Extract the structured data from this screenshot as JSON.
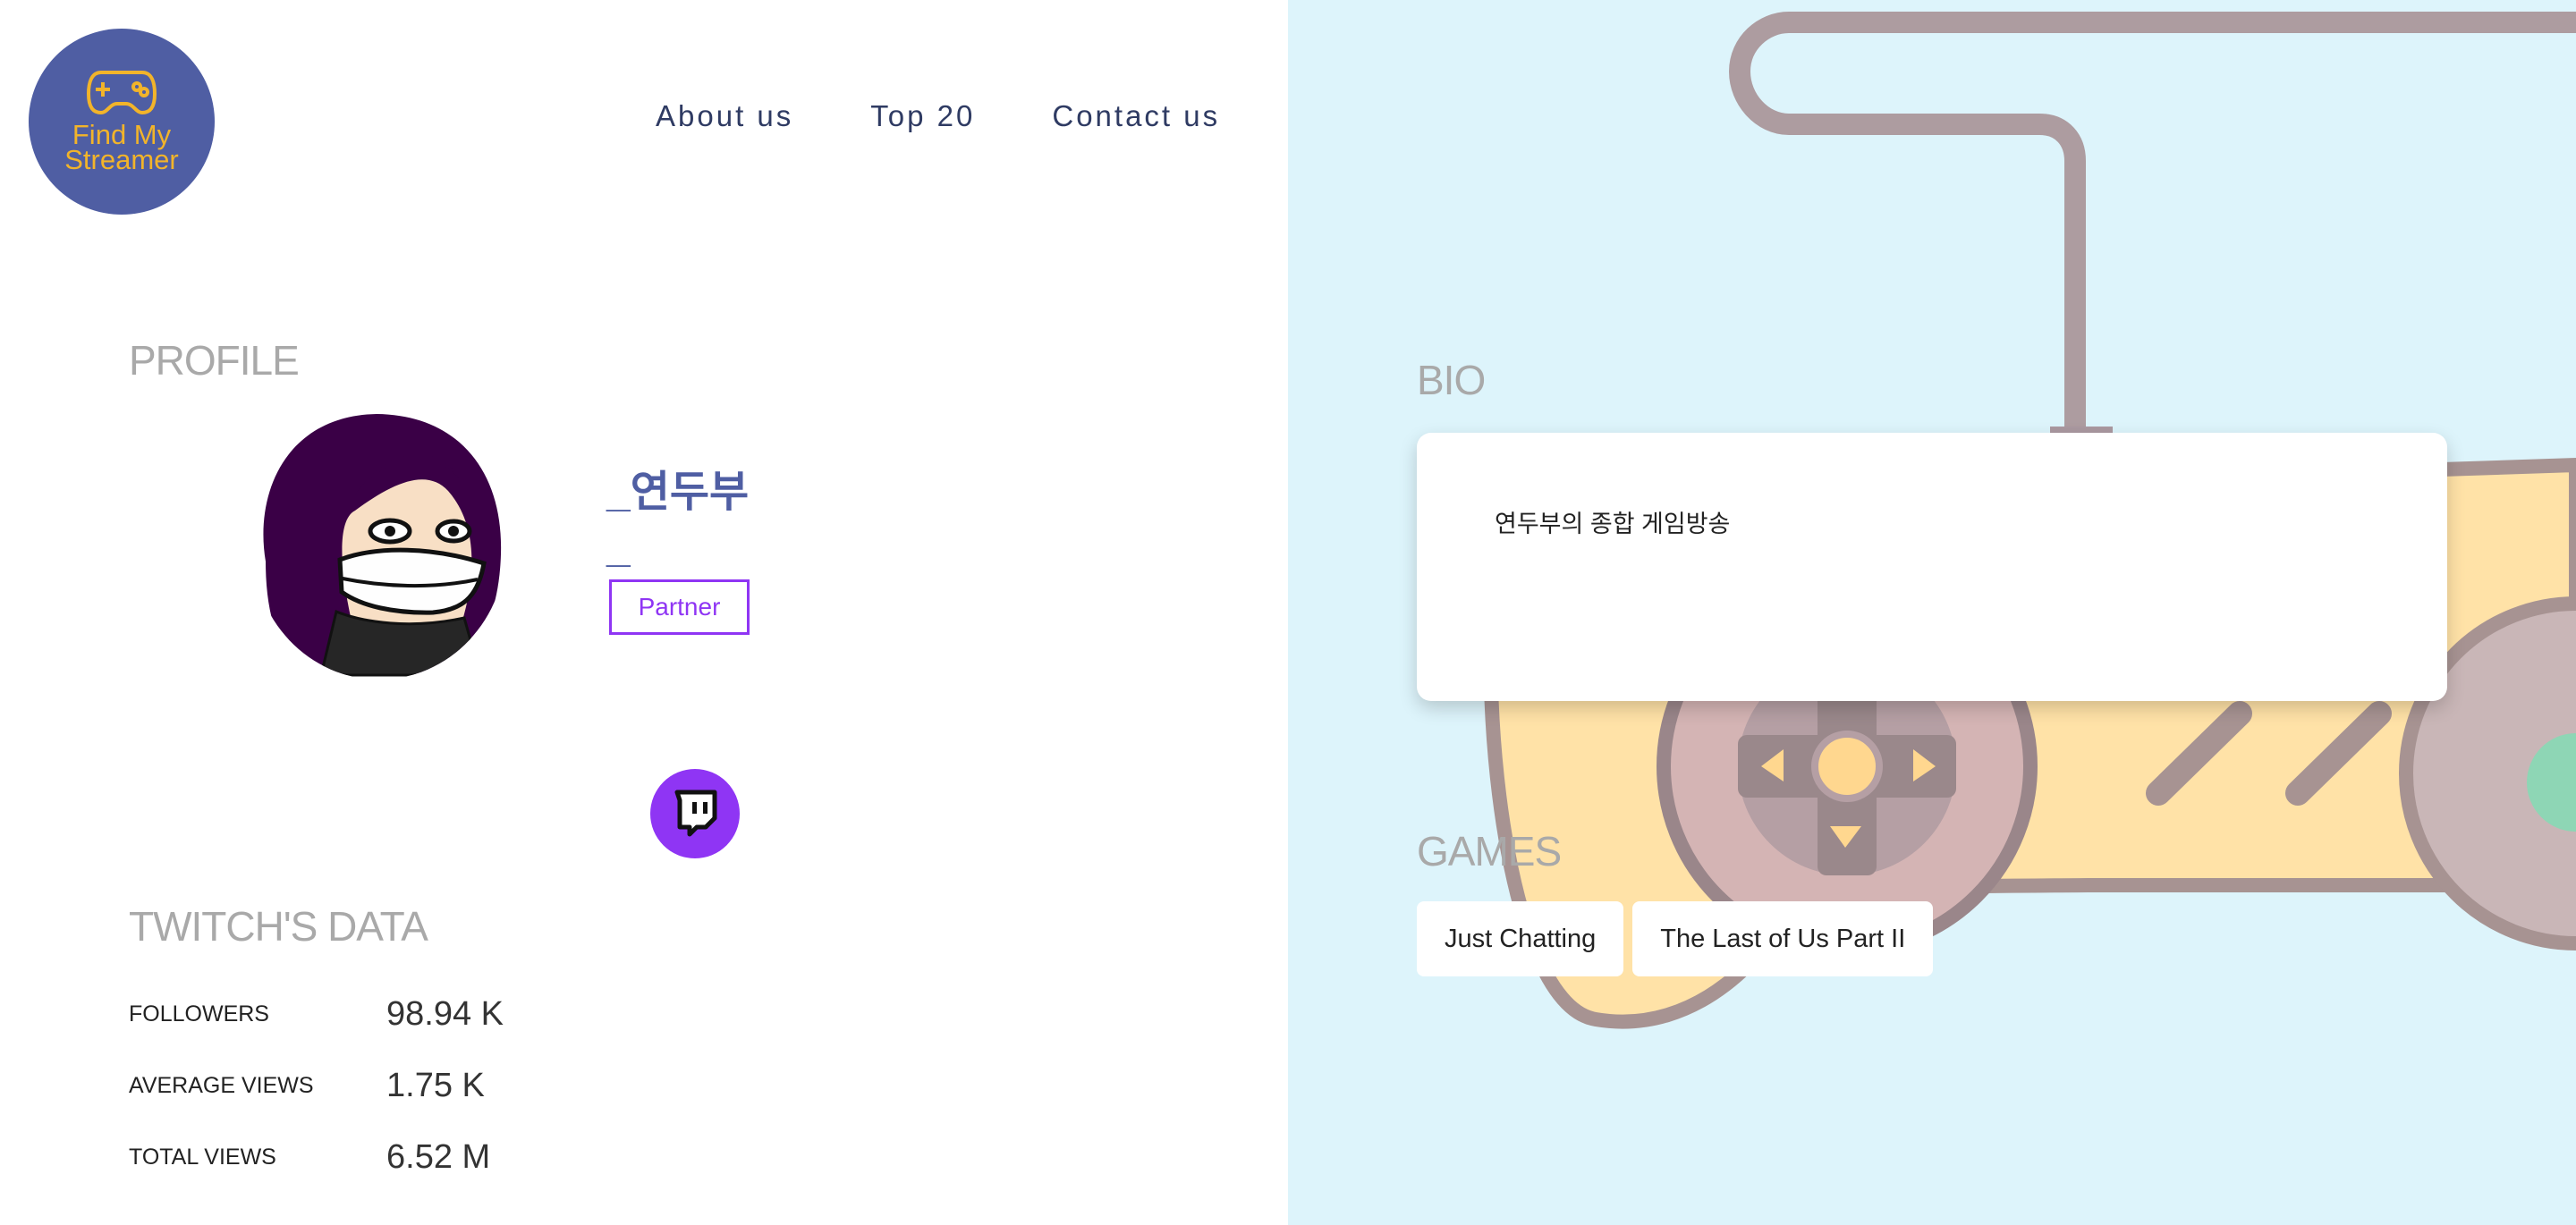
{
  "brand": {
    "logo_text": "Find My Streamer",
    "icon": "gamepad-icon",
    "colors": {
      "logo_bg": "#4f5ea3",
      "logo_fg": "#f2b42a"
    }
  },
  "nav": {
    "about": "About us",
    "top20": "Top 20",
    "contact": "Contact us"
  },
  "profile": {
    "section_title": "PROFILE",
    "username": "_연두부",
    "username_line2": "_",
    "badge": "Partner",
    "avatar_icon": "streamer-avatar",
    "twitch_icon": "twitch-icon"
  },
  "twitch_data": {
    "section_title": "TWITCH'S DATA",
    "followers_label": "FOLLOWERS",
    "followers_value": "98.94 K",
    "average_views_label": "AVERAGE VIEWS",
    "average_views_value": "1.75 K",
    "total_views_label": "TOTAL VIEWS",
    "total_views_value": "6.52 M"
  },
  "bio": {
    "section_title": "BIO",
    "text": "연두부의 종합 게임방송"
  },
  "games": {
    "section_title": "GAMES",
    "items": [
      "Just Chatting",
      "The Last of Us Part II"
    ]
  },
  "colors": {
    "accent": "#4f5ea3",
    "twitch_purple": "#8f35f4",
    "right_bg": "#ddf4fb"
  }
}
